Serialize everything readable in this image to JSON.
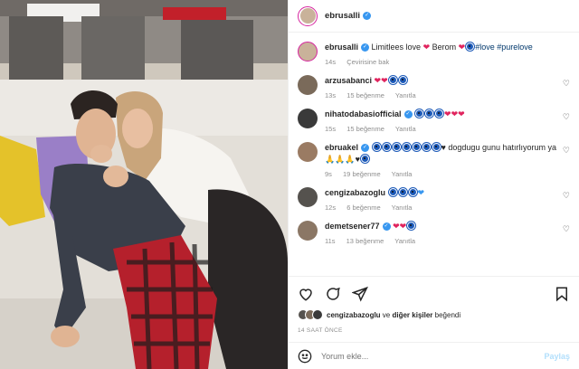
{
  "post": {
    "username": "ebrusalli",
    "caption_user": "ebrusalli",
    "caption_text": "Limitlees love",
    "caption_mid": "Berom",
    "hashtags": "#love #purelove",
    "caption_time": "14s",
    "translate_label": "Çevirisine bak"
  },
  "comments": [
    {
      "user": "arzusabanci",
      "time": "13s",
      "likes": "15 beğenme",
      "reply": "Yanıtla",
      "avatar_color": "#7a6a5a"
    },
    {
      "user": "nihatodabasiofficial",
      "time": "15s",
      "likes": "15 beğenme",
      "reply": "Yanıtla",
      "avatar_color": "#3a3a3a"
    },
    {
      "user": "ebruakel",
      "text": "dogdugu gunu hatırlıyorum ya",
      "time": "9s",
      "likes": "19 beğenme",
      "reply": "Yanıtla",
      "avatar_color": "#9a7b63"
    },
    {
      "user": "cengizabazoglu",
      "time": "12s",
      "likes": "6 beğenme",
      "reply": "Yanıtla",
      "avatar_color": "#55524e"
    },
    {
      "user": "demetsener77",
      "time": "11s",
      "likes": "13 beğenme",
      "reply": "Yanıtla",
      "avatar_color": "#8b7765"
    }
  ],
  "likes_line": {
    "user": "cengizabazoglu",
    "connector": "ve",
    "others": "diğer kişiler",
    "suffix": "beğendi"
  },
  "timestamp": "14 SAAT ÖNCE",
  "add_comment": {
    "placeholder": "Yorum ekle...",
    "post_label": "Paylaş"
  },
  "colors": {
    "accent_link": "#3897f0",
    "heart_red": "#e0245e",
    "hashtag": "#00376b",
    "muted": "#8e8e8e"
  },
  "icons": [
    "heart-icon",
    "comment-icon",
    "share-icon",
    "bookmark-icon",
    "emoji-icon",
    "more-icon"
  ]
}
